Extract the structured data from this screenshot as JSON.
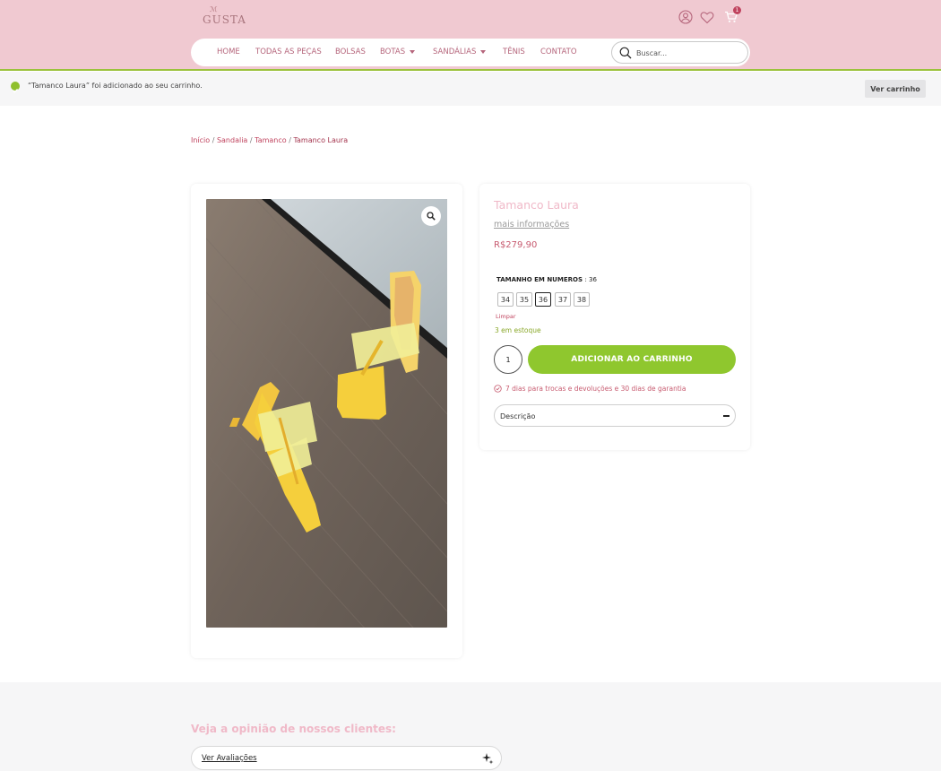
{
  "header": {
    "logo_crown": "ℳ",
    "logo_text": "GUSTA",
    "cart_count": "1",
    "nav": [
      {
        "label": "HOME"
      },
      {
        "label": "TODAS AS PEÇAS"
      },
      {
        "label": "BOLSAS"
      },
      {
        "label": "BOTAS"
      },
      {
        "label": "SANDÁLIAS"
      },
      {
        "label": "TÊNIS"
      },
      {
        "label": "CONTATO"
      }
    ],
    "search_placeholder": "Buscar...",
    "colors": {
      "background": "#f0c9d1",
      "accent_line": "#9bc23c",
      "nav_text": "#b5657b"
    }
  },
  "notice": {
    "message": "“Tamanco Laura” foi adicionado ao seu carrinho.",
    "view_cart": "Ver carrinho"
  },
  "breadcrumb": {
    "items": [
      "Início",
      "Sandalia",
      "Tamanco"
    ],
    "separator": " / ",
    "current": "Tamanco Laura"
  },
  "product": {
    "title": "Tamanco Laura",
    "more_info": "mais informações",
    "price": "R$279,90",
    "size_label": "TAMANHO EM NUMEROS",
    "selected_size": ": 36",
    "sizes": [
      "34",
      "35",
      "36",
      "37",
      "38"
    ],
    "active_size": "36",
    "clear": "Limpar",
    "stock": "3 em estoque",
    "quantity": "1",
    "add_to_cart": "ADICIONAR AO CARRINHO",
    "guarantee": "7 dias para trocas e devoluções e 30 dias de garantia",
    "description_toggle": "Descrição",
    "colors": {
      "title": "#f0b9c8",
      "price": "#c75a6f",
      "button": "#8fc72e"
    }
  },
  "gallery": {
    "zoom_icon": "magnifier-icon"
  },
  "reviews": {
    "title": "Veja a opinião de nossos clientes:",
    "button": "Ver Avaliações"
  }
}
